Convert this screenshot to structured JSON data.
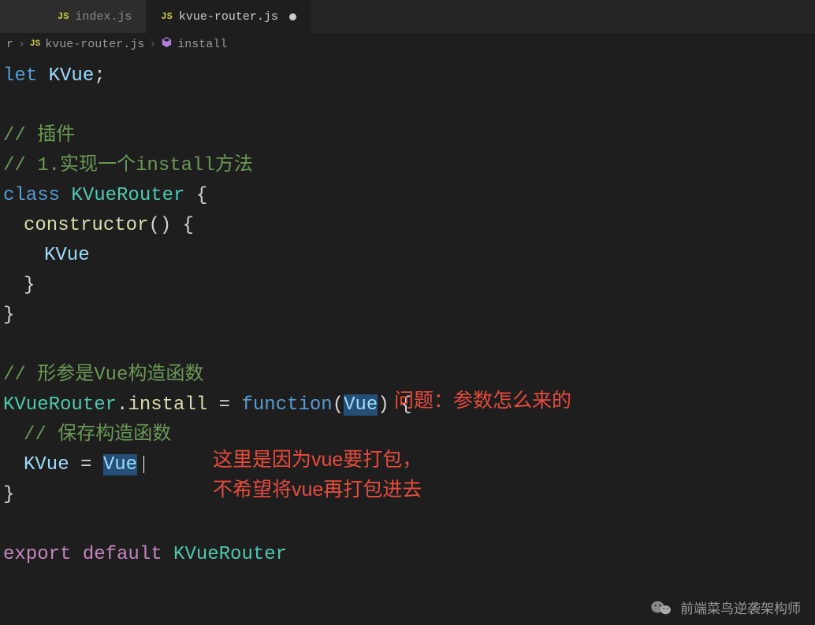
{
  "tabs": [
    {
      "icon": "JS",
      "label": "index.js",
      "active": false
    },
    {
      "icon": "JS",
      "label": "kvue-router.js",
      "active": true,
      "modified": true
    }
  ],
  "breadcrumb": {
    "part0": "r",
    "icon1": "JS",
    "part1": "kvue-router.js",
    "part2": "install"
  },
  "code": {
    "l1_let": "let",
    "l1_var": "KVue",
    "l1_semi": ";",
    "l3_cmt": "// 插件",
    "l4_cmt": "// 1.实现一个install方法",
    "l5_class": "class",
    "l5_name": "KVueRouter",
    "l5_brace": " {",
    "l6_ctor": "constructor",
    "l6_paren": "() {",
    "l7_kvue": "KVue",
    "l8_brace": "}",
    "l9_brace": "}",
    "l11_cmt": "// 形参是Vue构造函数",
    "l12_obj": "KVueRouter",
    "l12_dot": ".",
    "l12_inst": "install",
    "l12_eq": " = ",
    "l12_fn": "function",
    "l12_op": "(",
    "l12_param": "Vue",
    "l12_cp": ")",
    "l12_brace": " {",
    "l13_cmt": "// 保存构造函数",
    "l14_kvue": "KVue",
    "l14_eq": " = ",
    "l14_vue": "Vue",
    "l15_brace": "}",
    "l17_export": "export",
    "l17_default": " default ",
    "l17_name": "KVueRouter"
  },
  "annotations": {
    "a1": "问题：参数怎么来的",
    "a2_l1": "这里是因为vue要打包，",
    "a2_l2": "不希望将vue再打包进去"
  },
  "watermark": {
    "text": "前端菜鸟逆袭架构师"
  }
}
